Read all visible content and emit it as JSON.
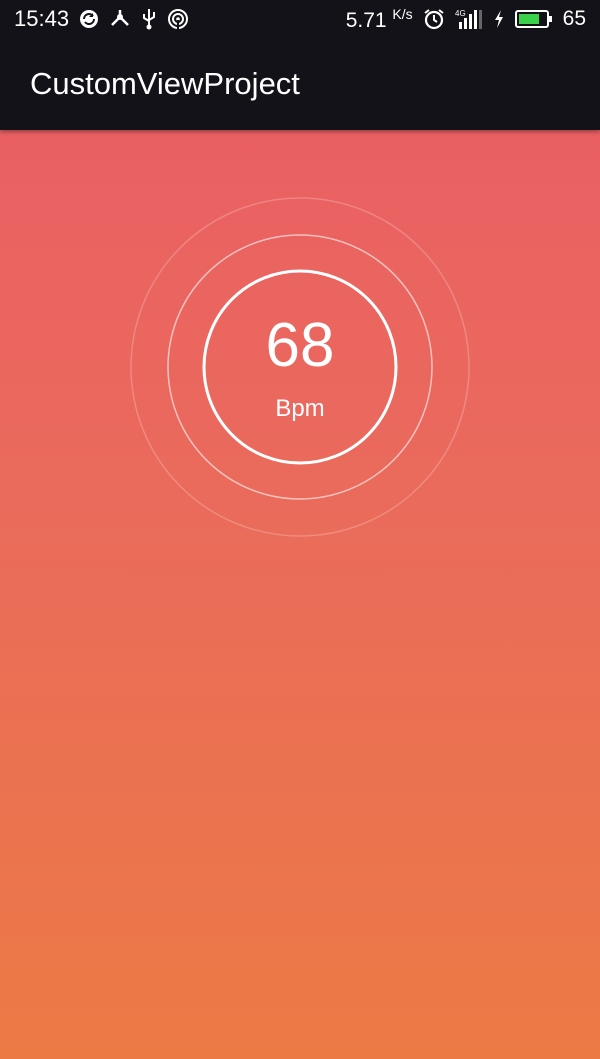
{
  "status_bar": {
    "time": "15:43",
    "icons_left": [
      "sync-icon",
      "usb-hub-icon",
      "usb-icon",
      "hotspot-icon"
    ],
    "network_speed": "5.71",
    "network_speed_unit": "K/s",
    "network_type": "4G",
    "icons_right": [
      "alarm-icon",
      "signal-icon",
      "charging-icon",
      "battery-icon"
    ],
    "battery_level": "65",
    "battery_color": "#3bd14a"
  },
  "app_bar": {
    "title": "CustomViewProject"
  },
  "heart_rate": {
    "value": "68",
    "unit": "Bpm"
  },
  "colors": {
    "gradient_top": "#e95c65",
    "gradient_bottom": "#ec7a45",
    "bar_background": "#121218"
  }
}
